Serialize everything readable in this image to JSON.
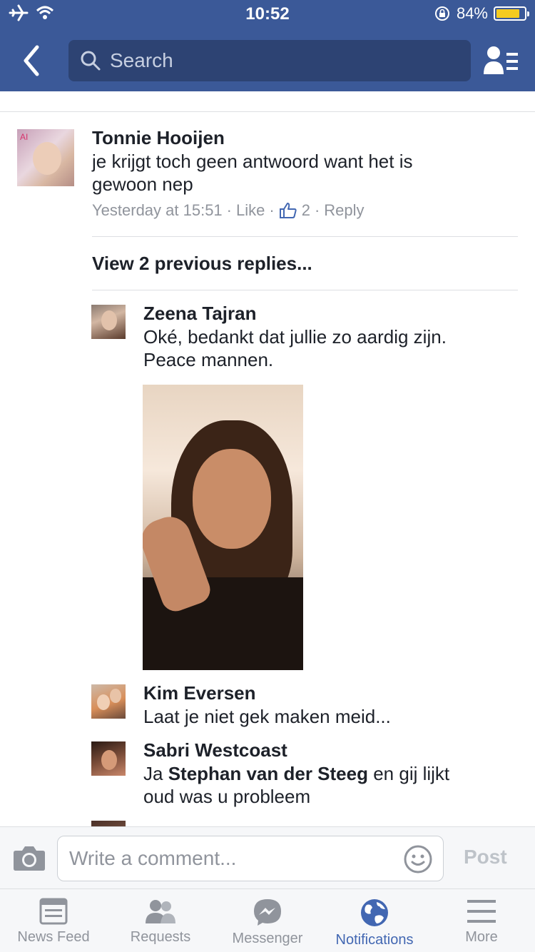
{
  "status_bar": {
    "time": "10:52",
    "battery": "84%",
    "battery_level": 0.84
  },
  "header": {
    "search_placeholder": "Search"
  },
  "comment": {
    "author": "Tonnie Hooijen",
    "text_line1": "je krijgt toch geen antwoord want het is",
    "text_line2": "gewoon nep",
    "timestamp": "Yesterday at 15:51",
    "like_label": "Like",
    "like_count": "2",
    "reply_label": "Reply",
    "avatar_overlay_text": "AI"
  },
  "view_previous": "View 2 previous replies...",
  "replies": [
    {
      "author": "Zeena Tajran",
      "line1": "Oké, bedankt dat jullie zo aardig zijn.",
      "line2": "Peace mannen."
    },
    {
      "author": "Kim Eversen",
      "line1": "Laat je niet gek maken meid..."
    },
    {
      "author": "Sabri Westcoast",
      "line1_prefix": "Ja ",
      "mention": "Stephan van der Steeg",
      "line1_suffix": " en gij lijkt",
      "line2": "oud was u probleem"
    }
  ],
  "composer": {
    "placeholder": "Write a comment...",
    "post_label": "Post"
  },
  "tabs": [
    {
      "label": "News Feed",
      "icon": "news-feed-icon",
      "active": false
    },
    {
      "label": "Requests",
      "icon": "friend-requests-icon",
      "active": false
    },
    {
      "label": "Messenger",
      "icon": "messenger-icon",
      "active": false
    },
    {
      "label": "Notifications",
      "icon": "globe-icon",
      "active": true
    },
    {
      "label": "More",
      "icon": "menu-icon",
      "active": false
    }
  ],
  "colors": {
    "brand": "#3b5998",
    "brand_dark": "#2d4373",
    "active_tab": "#4267b2",
    "muted": "#90949c",
    "battery": "#f5cb20"
  }
}
